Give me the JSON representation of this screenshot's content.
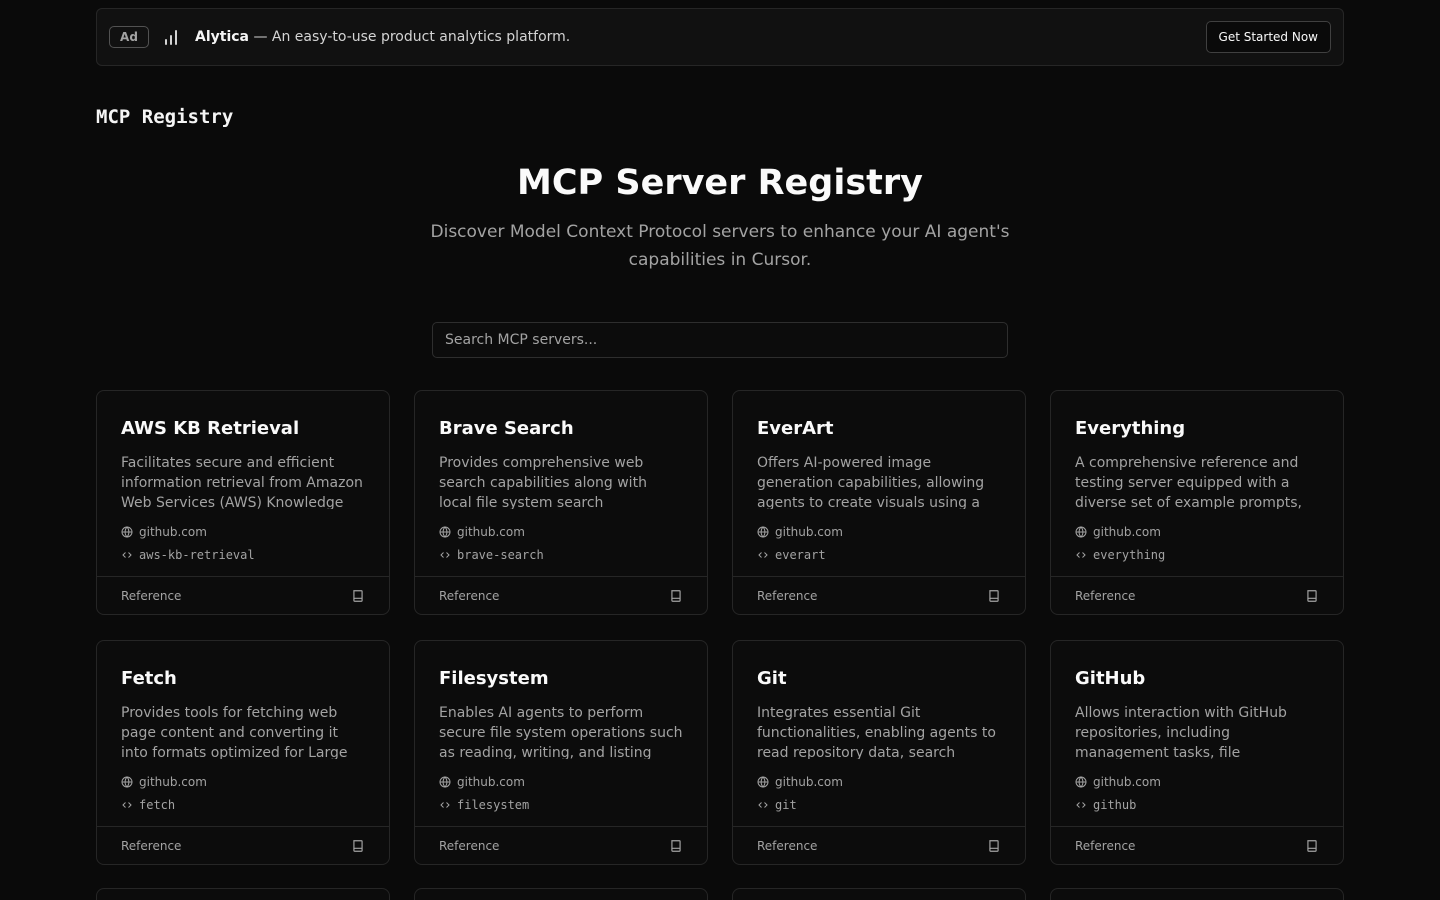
{
  "ad": {
    "badge": "Ad",
    "brand": "Alytica",
    "tagline": " — An easy-to-use product analytics platform.",
    "cta": "Get Started Now",
    "logo_icon": "bar-chart-icon"
  },
  "site": {
    "logo": "MCP Registry"
  },
  "hero": {
    "title": "MCP Server Registry",
    "subtitle": "Discover Model Context Protocol servers to enhance your AI agent's capabilities in Cursor."
  },
  "search": {
    "placeholder": "Search MCP servers...",
    "value": ""
  },
  "cards": [
    {
      "title": "AWS KB Retrieval",
      "description": "Facilitates secure and efficient information retrieval from Amazon Web Services (AWS) Knowledge",
      "host": "github.com",
      "slug": "aws-kb-retrieval",
      "category": "Reference"
    },
    {
      "title": "Brave Search",
      "description": "Provides comprehensive web search capabilities along with local file system search",
      "host": "github.com",
      "slug": "brave-search",
      "category": "Reference"
    },
    {
      "title": "EverArt",
      "description": "Offers AI-powered image generation capabilities, allowing agents to create visuals using a",
      "host": "github.com",
      "slug": "everart",
      "category": "Reference"
    },
    {
      "title": "Everything",
      "description": "A comprehensive reference and testing server equipped with a diverse set of example prompts,",
      "host": "github.com",
      "slug": "everything",
      "category": "Reference"
    },
    {
      "title": "Fetch",
      "description": "Provides tools for fetching web page content and converting it into formats optimized for Large",
      "host": "github.com",
      "slug": "fetch",
      "category": "Reference"
    },
    {
      "title": "Filesystem",
      "description": "Enables AI agents to perform secure file system operations such as reading, writing, and listing",
      "host": "github.com",
      "slug": "filesystem",
      "category": "Reference"
    },
    {
      "title": "Git",
      "description": "Integrates essential Git functionalities, enabling agents to read repository data, search",
      "host": "github.com",
      "slug": "git",
      "category": "Reference"
    },
    {
      "title": "GitHub",
      "description": "Allows interaction with GitHub repositories, including management tasks, file",
      "host": "github.com",
      "slug": "github",
      "category": "Reference"
    }
  ],
  "icons": {
    "host": "globe-icon",
    "slug": "code-icon",
    "footer": "book-icon"
  }
}
